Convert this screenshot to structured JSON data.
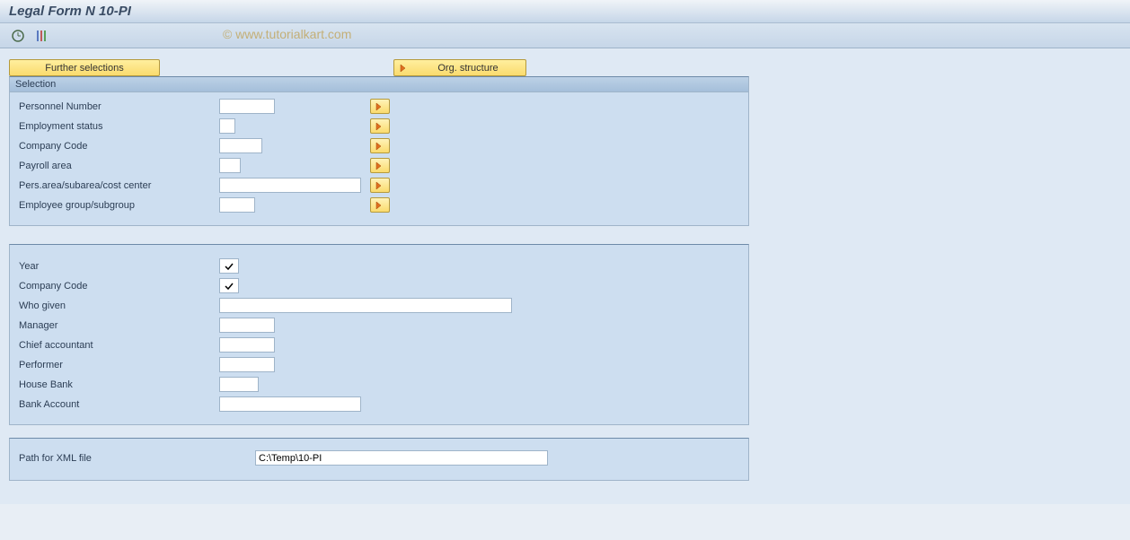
{
  "title": "Legal Form N 10-PI",
  "watermark": "© www.tutorialkart.com",
  "buttons": {
    "further_selections": "Further selections",
    "org_structure": "Org. structure"
  },
  "selection": {
    "header": "Selection",
    "fields": {
      "personnel_number": {
        "label": "Personnel Number",
        "value": ""
      },
      "employment_status": {
        "label": "Employment status",
        "value": ""
      },
      "company_code": {
        "label": "Company Code",
        "value": ""
      },
      "payroll_area": {
        "label": "Payroll area",
        "value": ""
      },
      "pers_area": {
        "label": "Pers.area/subarea/cost center",
        "value": ""
      },
      "employee_group": {
        "label": "Employee group/subgroup",
        "value": ""
      }
    }
  },
  "params": {
    "year": {
      "label": "Year",
      "checked": true
    },
    "company_code": {
      "label": "Company Code",
      "checked": true
    },
    "who_given": {
      "label": "Who given",
      "value": ""
    },
    "manager": {
      "label": "Manager",
      "value": ""
    },
    "chief_accountant": {
      "label": "Chief accountant",
      "value": ""
    },
    "performer": {
      "label": "Performer",
      "value": ""
    },
    "house_bank": {
      "label": "House Bank",
      "value": ""
    },
    "bank_account": {
      "label": "Bank Account",
      "value": ""
    }
  },
  "xml": {
    "label": "Path for XML file",
    "value": "C:\\Temp\\10-PI"
  }
}
